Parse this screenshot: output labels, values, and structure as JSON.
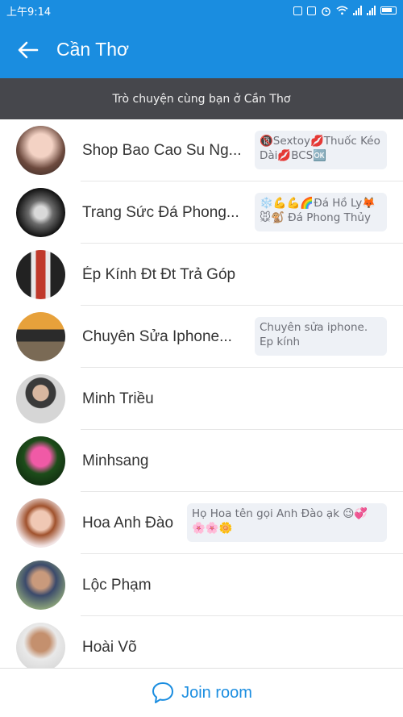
{
  "status": {
    "time": "上午9:14"
  },
  "appbar": {
    "title": "Cần Thơ"
  },
  "banner": {
    "text": "Trò chuyện cùng bạn ở Cần Thơ"
  },
  "rows": [
    {
      "name": "Shop Bao Cao Su Ng...",
      "bubble": "🔞Sextoy💋Thuốc Kéo Dài💋BCS🆗"
    },
    {
      "name": "Trang Sức Đá Phong...",
      "bubble": "❄️💪💪🌈Đá Hồ Ly🦊 🐭🐒 Đá Phong Thủy"
    },
    {
      "name": "Ép Kính Đt  Đt Trả Góp",
      "bubble": ""
    },
    {
      "name": "Chuyên Sửa Iphone...",
      "bubble": "Chuyên sửa iphone. Ep kính"
    },
    {
      "name": "Minh Triều",
      "bubble": ""
    },
    {
      "name": "Minhsang",
      "bubble": ""
    },
    {
      "name": "Hoa Anh Đào",
      "bubble": "Họ Hoa tên gọi Anh Đào ạk 😉💞 🌸🌸🌼"
    },
    {
      "name": "Lộc Phạm",
      "bubble": ""
    },
    {
      "name": "Hoài Võ",
      "bubble": ""
    }
  ],
  "footer": {
    "join_label": "Join room"
  },
  "colors": {
    "primary": "#1a8de0",
    "banner": "#46474c",
    "bubble": "#eef1f6"
  }
}
